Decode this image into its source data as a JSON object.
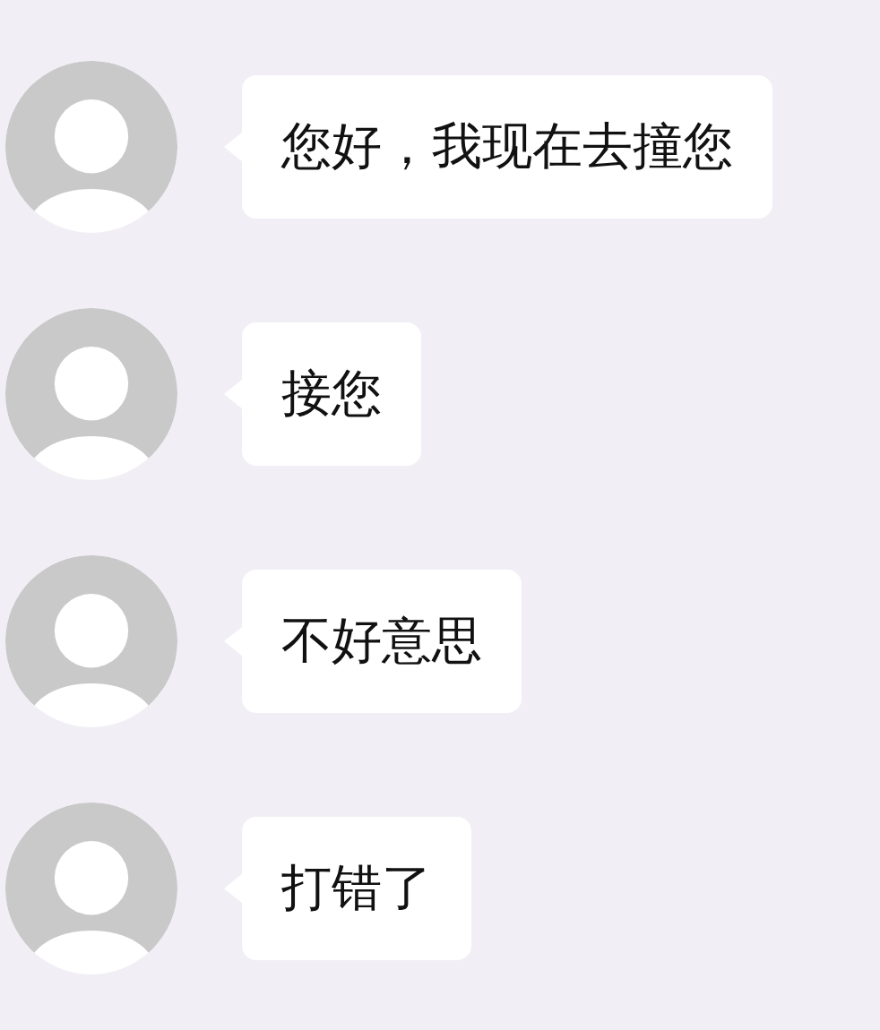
{
  "messages": [
    {
      "text": "您好，我现在去撞您"
    },
    {
      "text": "接您"
    },
    {
      "text": "不好意思"
    },
    {
      "text": "打错了"
    }
  ]
}
